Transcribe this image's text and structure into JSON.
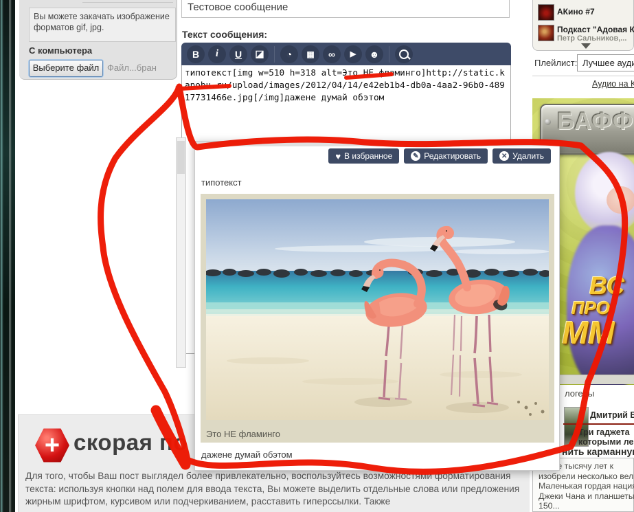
{
  "upload_panel": {
    "hint": "Вы можете закачать изображение форматов gif, jpg.",
    "from_computer_label": "С компьютера",
    "choose_file_button": "Выберите файл",
    "file_status": "Файл...бран"
  },
  "editor": {
    "title_value": "Тестовое сообщение",
    "message_label": "Текст сообщения:",
    "toolbar": {
      "bold": "B",
      "italic": "i",
      "underline": "U",
      "eraser": "◪",
      "clock": "◔",
      "image": "▦",
      "link": "∞",
      "video": "▶",
      "user": "☻"
    },
    "body_value": "типотекст[img w=510 h=318 alt=Это НЕ фламинго]http://static.kanobu.ru/upload/images/2012/04/14/e42eb1b4-db0a-4aa2-96b0-48917731466e.jpg[/img]дажене думай обэтом"
  },
  "popup": {
    "favorite_button": "В избранное",
    "edit_button": "Редактировать",
    "delete_button": "Удалить",
    "favorite_icon": "♥",
    "edit_icon": "✎",
    "delete_icon": "✕",
    "body_text": "типотекст",
    "image_caption": "Это НЕ фламинго",
    "after_text": "дажене думай обэтом"
  },
  "sidebar": {
    "audio": {
      "items": [
        {
          "title": "АКино #7",
          "subtitle": ""
        },
        {
          "title": "Подкаст \"Адовая К",
          "subtitle": "Петр Сальников,..."
        }
      ],
      "playlist_label": "Плейлист:",
      "playlist_value": "Лучшее аудио",
      "link": "Аудио на Ка"
    },
    "banner": {
      "plate_text": "БАФФ",
      "line1": "ВС",
      "line2": "ПРО",
      "line3": "ММ"
    },
    "bloggers": {
      "header": "логеры",
      "author": "Дмитрий Вес",
      "post_line1": "Три гаджета",
      "post_line2": "которыми ле",
      "post_line3": "нить карманную",
      "teaser_lines": [
        "едние тысячу лет к",
        "изобрели несколько велики",
        "Маленькая гордая нация пр",
        "Джеки Чана и планшеты на",
        "150..."
      ]
    }
  },
  "footer": {
    "heading": "скорая по",
    "plus_icon": "+",
    "paragraph": "Для того, чтобы Ваш пост выглядел более привлекательно, воспользуйтесь возможностями форматирования текста: используя кнопки над полем для ввода текста, Вы можете выделить отдельные слова или предложения жирным шрифтом, курсивом или подчеркиванием, расставить гиперссылки. Также"
  },
  "colors": {
    "toolbar_navy": "#3e4b68",
    "button_navy": "#3d4a64",
    "marker_red": "#ed1702",
    "panel_beige": "#ddd9c4",
    "banner_gold": "#f5c631",
    "footer_gray": "#ececec"
  }
}
